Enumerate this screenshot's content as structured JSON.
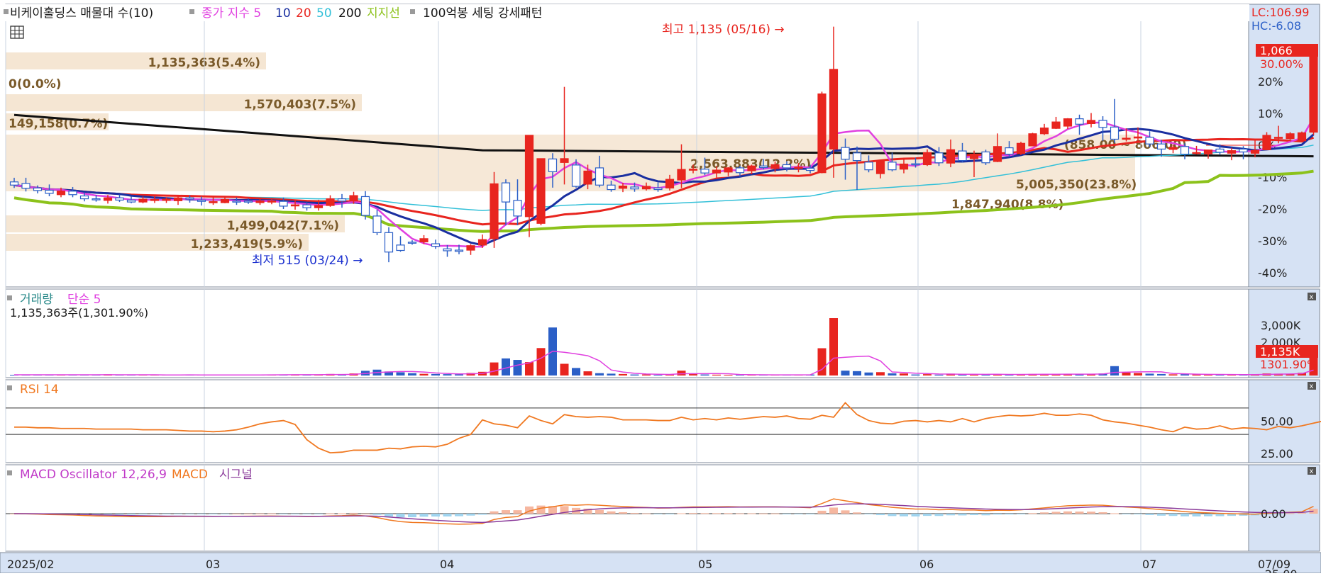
{
  "header": {
    "stock_title": "비케이홀딩스 매물대 수(10)",
    "close_label": "종가 지수 5",
    "ma": [
      "10",
      "20",
      "50",
      "200"
    ],
    "support_label": "지지선",
    "pattern_label": "100억봉 세팅 강세패턴"
  },
  "right_labels": {
    "lc": "LC:106.99",
    "hc": "HC:-6.08",
    "last_price": "1,066",
    "last_pct": "30.00%"
  },
  "annotations": {
    "high": "최고 1,135 (05/16) →",
    "low": "최저 515 (03/24) →"
  },
  "volume_panel": {
    "title": "거래량",
    "ma_label": "단순 5",
    "info": "1,135,363주(1,301.90%)",
    "badge": "1,135K",
    "badge_pct": "1301.90%"
  },
  "rsi_panel": {
    "title": "RSI 14"
  },
  "macd_panel": {
    "title": "MACD Oscillator 12,26,9",
    "macd_label": "MACD",
    "signal_label": "시그널"
  },
  "colors": {
    "up": "#e8251f",
    "down": "#2b5fc7",
    "ma5": "#e040e0",
    "ma10": "#1a2fa0",
    "ma20": "#e8251f",
    "ma50": "#33c0d8",
    "ma200": "#111111",
    "support": "#8cc21b",
    "vp": "#f5e6d3",
    "vp_text": "#7a5a2a",
    "rsi": "#f07820",
    "macd_pos": "#f6b7a0",
    "macd_neg": "#9fd4ef",
    "signal": "#8a3a9a"
  },
  "chart_data": {
    "type": "candlestick",
    "x_ticks": [
      "2025/02",
      "03",
      "04",
      "05",
      "06",
      "07",
      "07/09"
    ],
    "price_axis": {
      "ticks": [
        "30.00%",
        "20%",
        "10%",
        "0%",
        "-10%",
        "-20%",
        "-30%",
        "-40%"
      ]
    },
    "volume_axis": {
      "ticks": [
        "3,000K",
        "2,000K"
      ]
    },
    "rsi_axis": {
      "ticks": [
        "50.00"
      ]
    },
    "macd_axis": {
      "ticks": [
        "25.00",
        "0.00",
        "-25.00"
      ]
    },
    "volume_profile": [
      {
        "label": "1,135,363(5.4%)",
        "pct": 5.4
      },
      {
        "label": "0(0.0%)",
        "pct": 0
      },
      {
        "label": "1,570,403(7.5%)",
        "pct": 7.5
      },
      {
        "label": "149,158(0.7%)",
        "pct": 0.7
      },
      {
        "label": "5,005,350(23.8%)",
        "pct": 23.8
      },
      {
        "label": "2,563,883(12.2%)",
        "pct": 12.2
      },
      {
        "label": "1,847,940(8.8%)",
        "pct": 8.8
      },
      {
        "label": "1,499,042(7.1%)",
        "pct": 7.1
      },
      {
        "label": "1,233,419(5.9%)",
        "pct": 5.9
      }
    ],
    "max_zone_label": "(858.00 ~ 806.00)",
    "candles": [
      {
        "o": -11.5,
        "h": -10.2,
        "l": -13.4,
        "c": -12.5,
        "v": 40
      },
      {
        "o": -12,
        "h": -10.2,
        "l": -14.5,
        "c": -13.5,
        "v": 50
      },
      {
        "o": -13.4,
        "h": -12.6,
        "l": -15.1,
        "c": -14.2,
        "v": 40
      },
      {
        "o": -14.1,
        "h": -12.3,
        "l": -16,
        "c": -15.1,
        "v": 50
      },
      {
        "o": -15.5,
        "h": -13.3,
        "l": -16.3,
        "c": -14.4,
        "v": 40
      },
      {
        "o": -14.4,
        "h": -13.1,
        "l": -16.3,
        "c": -15.5,
        "v": 35
      },
      {
        "o": -15.9,
        "h": -14.8,
        "l": -17.6,
        "c": -16.8,
        "v": 50
      },
      {
        "o": -16.8,
        "h": -15.6,
        "l": -17.7,
        "c": -17.1,
        "v": 40
      },
      {
        "o": -17.3,
        "h": -15.6,
        "l": -18.3,
        "c": -16.5,
        "v": 70
      },
      {
        "o": -16.5,
        "h": -15.5,
        "l": -17.8,
        "c": -17.2,
        "v": 30
      },
      {
        "o": -17.2,
        "h": -16.1,
        "l": -18.2,
        "c": -17.8,
        "v": 25
      },
      {
        "o": -17.8,
        "h": -16.1,
        "l": -18.2,
        "c": -16.9,
        "v": 40
      },
      {
        "o": -17.1,
        "h": -15.9,
        "l": -18.1,
        "c": -17,
        "v": 40
      },
      {
        "o": -17.3,
        "h": -16.4,
        "l": -18.1,
        "c": -16.9,
        "v": 30
      },
      {
        "o": -17.4,
        "h": -16.1,
        "l": -18.7,
        "c": -16.5,
        "v": 35
      },
      {
        "o": -16.5,
        "h": -15.7,
        "l": -18,
        "c": -16.9,
        "v": 30
      },
      {
        "o": -17.2,
        "h": -16.1,
        "l": -18.9,
        "c": -17.6,
        "v": 30
      },
      {
        "o": -18,
        "h": -16.4,
        "l": -18.7,
        "c": -17.7,
        "v": 25
      },
      {
        "o": -18,
        "h": -16.1,
        "l": -18.2,
        "c": -17,
        "v": 30
      },
      {
        "o": -17.5,
        "h": -16.4,
        "l": -18.7,
        "c": -17.7,
        "v": 35
      },
      {
        "o": -17.5,
        "h": -16.7,
        "l": -18.4,
        "c": -17.7,
        "v": 30
      },
      {
        "o": -18,
        "h": -16.4,
        "l": -18.7,
        "c": -17.5,
        "v": 40
      },
      {
        "o": -17.8,
        "h": -16.7,
        "l": -18.5,
        "c": -17.5,
        "v": 50
      },
      {
        "o": -17.6,
        "h": -16.4,
        "l": -20,
        "c": -19.1,
        "v": 60
      },
      {
        "o": -19,
        "h": -17.1,
        "l": -20.2,
        "c": -18.7,
        "v": 60
      },
      {
        "o": -18.7,
        "h": -17.9,
        "l": -20.5,
        "c": -19.6,
        "v": 40
      },
      {
        "o": -19.6,
        "h": -17.1,
        "l": -20.5,
        "c": -18.9,
        "v": 35
      },
      {
        "o": -18.9,
        "h": -15.7,
        "l": -19.3,
        "c": -16.8,
        "v": 90
      },
      {
        "o": -16.8,
        "h": -15.3,
        "l": -19.6,
        "c": -17.5,
        "v": 70
      },
      {
        "o": -17.5,
        "h": -14.6,
        "l": -18.4,
        "c": -15.8,
        "v": 120
      },
      {
        "o": -16.1,
        "h": -14.4,
        "l": -23.3,
        "c": -22,
        "v": 280
      },
      {
        "o": -22.2,
        "h": -20.2,
        "l": -28.2,
        "c": -27.4,
        "v": 350
      },
      {
        "o": -27.4,
        "h": -25.7,
        "l": -36.7,
        "c": -33.5,
        "v": 240
      },
      {
        "o": -31.3,
        "h": -28.5,
        "l": -33.4,
        "c": -33,
        "v": 190
      },
      {
        "o": -30.4,
        "h": -29.8,
        "l": -31.2,
        "c": -30.6,
        "v": 140
      },
      {
        "o": -30.3,
        "h": -28.2,
        "l": -31,
        "c": -29.3,
        "v": 100
      },
      {
        "o": -30.9,
        "h": -29.6,
        "l": -32.5,
        "c": -31.7,
        "v": 90
      },
      {
        "o": -32.5,
        "h": -31.3,
        "l": -35,
        "c": -33.1,
        "v": 80
      },
      {
        "o": -32.9,
        "h": -31.2,
        "l": -34.2,
        "c": -33.3,
        "v": 70
      },
      {
        "o": -32.9,
        "h": -31,
        "l": -34.4,
        "c": -31.5,
        "v": 150
      },
      {
        "o": -31.3,
        "h": -28,
        "l": -32.2,
        "c": -29.6,
        "v": 220
      },
      {
        "o": -29.3,
        "h": -8.4,
        "l": -32.2,
        "c": -12.1,
        "v": 780
      },
      {
        "o": -11.8,
        "h": -10.7,
        "l": -25.1,
        "c": -17.8,
        "v": 1020
      },
      {
        "o": -17.3,
        "h": -10.7,
        "l": -25.1,
        "c": -22.2,
        "v": 930
      },
      {
        "o": -22.4,
        "h": 3.2,
        "l": -28.8,
        "c": 3.1,
        "v": 800
      },
      {
        "o": -24.5,
        "h": -5.1,
        "l": -25.1,
        "c": -4.2,
        "v": 1640
      },
      {
        "o": -4.3,
        "h": -2.5,
        "l": -13.3,
        "c": -8.3,
        "v": 2870
      },
      {
        "o": -5.4,
        "h": 18.3,
        "l": -12.3,
        "c": -4.2,
        "v": 700
      },
      {
        "o": -6.2,
        "h": -4.4,
        "l": -13.3,
        "c": -12.9,
        "v": 450
      },
      {
        "o": -12.2,
        "h": -6.1,
        "l": -13.8,
        "c": -8.1,
        "v": 250
      },
      {
        "o": -7.1,
        "h": -3.3,
        "l": -13.2,
        "c": -12.5,
        "v": 140
      },
      {
        "o": -12.5,
        "h": -11.1,
        "l": -14.6,
        "c": -13.9,
        "v": 110
      },
      {
        "o": -13.5,
        "h": -11.8,
        "l": -14.7,
        "c": -12.8,
        "v": 90
      },
      {
        "o": -13.1,
        "h": -11.7,
        "l": -14.6,
        "c": -13.7,
        "v": 60
      },
      {
        "o": -13.7,
        "h": -11.7,
        "l": -14.2,
        "c": -12.9,
        "v": 60
      },
      {
        "o": -13.4,
        "h": -11.7,
        "l": -14.6,
        "c": -13.9,
        "v": 40
      },
      {
        "o": -13.4,
        "h": -9.3,
        "l": -14.2,
        "c": -10.7,
        "v": 80
      },
      {
        "o": -10.9,
        "h": 0.3,
        "l": -13.4,
        "c": -7.6,
        "v": 290
      },
      {
        "o": -7.6,
        "h": -6.1,
        "l": -8.8,
        "c": -7.5,
        "v": 90
      },
      {
        "o": -7.5,
        "h": -3.9,
        "l": -9.4,
        "c": -8.7,
        "v": 60
      },
      {
        "o": -8.7,
        "h": -6.5,
        "l": -10.1,
        "c": -7.8,
        "v": 50
      },
      {
        "o": -8.4,
        "h": -6.9,
        "l": -9.7,
        "c": -7.1,
        "v": 40
      },
      {
        "o": -7.1,
        "h": -6.4,
        "l": -9.8,
        "c": -8.6,
        "v": 40
      },
      {
        "o": -8,
        "h": -6.1,
        "l": -9.1,
        "c": -6.5,
        "v": 40
      },
      {
        "o": -6.5,
        "h": -4.3,
        "l": -7.6,
        "c": -7,
        "v": 30
      },
      {
        "o": -7.3,
        "h": -5.1,
        "l": -8.5,
        "c": -6.1,
        "v": 40
      },
      {
        "o": -6.1,
        "h": -5,
        "l": -8.2,
        "c": -7.1,
        "v": 30
      },
      {
        "o": -7.3,
        "h": -5.6,
        "l": -8.5,
        "c": -6.9,
        "v": 50
      },
      {
        "o": -7.2,
        "h": -6.1,
        "l": -8.8,
        "c": -7.9,
        "v": 60
      },
      {
        "o": -8.6,
        "h": 16.8,
        "l": -8.8,
        "c": 16.1,
        "v": 1630
      },
      {
        "o": -1.2,
        "h": 37.2,
        "l": -10.2,
        "c": 23.8,
        "v": 3430
      },
      {
        "o": -0.7,
        "h": 2.1,
        "l": -10.8,
        "c": -4.4,
        "v": 290
      },
      {
        "o": -2.4,
        "h": -0.4,
        "l": -14,
        "c": -4.8,
        "v": 260
      },
      {
        "o": -5.3,
        "h": -3.2,
        "l": -8.5,
        "c": -7.7,
        "v": 180
      },
      {
        "o": -8.9,
        "h": -4.7,
        "l": -10.4,
        "c": -4.9,
        "v": 200
      },
      {
        "o": -5.3,
        "h": -2.3,
        "l": -8.2,
        "c": -7.7,
        "v": 130
      },
      {
        "o": -7.5,
        "h": -4.4,
        "l": -8.8,
        "c": -5.9,
        "v": 120
      },
      {
        "o": -5.8,
        "h": -3.9,
        "l": -7,
        "c": -6,
        "v": 60
      },
      {
        "o": -6.1,
        "h": -1.3,
        "l": -6.5,
        "c": -2.3,
        "v": 80
      },
      {
        "o": -2.4,
        "h": -0.6,
        "l": -6.5,
        "c": -5.5,
        "v": 50
      },
      {
        "o": -5.6,
        "h": 1.8,
        "l": -6.9,
        "c": -1.4,
        "v": 110
      },
      {
        "o": -1.8,
        "h": 0.7,
        "l": -5.4,
        "c": -4.8,
        "v": 80
      },
      {
        "o": -4.2,
        "h": -1.7,
        "l": -10,
        "c": -2.8,
        "v": 60
      },
      {
        "o": -2.1,
        "h": -1.4,
        "l": -6.2,
        "c": -5.5,
        "v": 50
      },
      {
        "o": -5.1,
        "h": 3.7,
        "l": -5.3,
        "c": -0.4,
        "v": 70
      },
      {
        "o": -0.8,
        "h": 1.3,
        "l": -3.7,
        "c": -2.8,
        "v": 60
      },
      {
        "o": -2.6,
        "h": 1.1,
        "l": -3.1,
        "c": 0.6,
        "v": 80
      },
      {
        "o": -0.2,
        "h": 3.9,
        "l": -0.3,
        "c": 3.6,
        "v": 90
      },
      {
        "o": 3.6,
        "h": 6.7,
        "l": 3.2,
        "c": 5.4,
        "v": 70
      },
      {
        "o": 5.3,
        "h": 8.9,
        "l": 5.1,
        "c": 7.3,
        "v": 80
      },
      {
        "o": 6,
        "h": 8.5,
        "l": 5.1,
        "c": 8.3,
        "v": 90
      },
      {
        "o": 8.3,
        "h": 9.6,
        "l": 3.3,
        "c": 6.6,
        "v": 70
      },
      {
        "o": 6.8,
        "h": 10.1,
        "l": 5.6,
        "c": 7.8,
        "v": 80
      },
      {
        "o": 7.8,
        "h": 9.1,
        "l": 1.4,
        "c": 5.6,
        "v": 120
      },
      {
        "o": 5.7,
        "h": 14.5,
        "l": 0.7,
        "c": 1.9,
        "v": 560
      },
      {
        "o": 2,
        "h": 5.3,
        "l": 1.2,
        "c": 2.2,
        "v": 180
      },
      {
        "o": 2.3,
        "h": 5.6,
        "l": 1.1,
        "c": 2.6,
        "v": 150
      },
      {
        "o": 2.5,
        "h": 4.4,
        "l": -0.6,
        "c": 0.4,
        "v": 110
      },
      {
        "o": 0.4,
        "h": 1.7,
        "l": -3.6,
        "c": -1.2,
        "v": 90
      },
      {
        "o": -1.3,
        "h": 0.1,
        "l": -2.5,
        "c": -0.7,
        "v": 70
      },
      {
        "o": -0.4,
        "h": 0.6,
        "l": -4.4,
        "c": -2.8,
        "v": 80
      },
      {
        "o": -2.4,
        "h": -0.2,
        "l": -2.9,
        "c": -2.3,
        "v": 60
      },
      {
        "o": -2.7,
        "h": -1.4,
        "l": -4.2,
        "c": -1.5,
        "v": 50
      },
      {
        "o": -1.2,
        "h": 0.3,
        "l": -3,
        "c": -2.2,
        "v": 50
      },
      {
        "o": -2.5,
        "h": -0.8,
        "l": -4.7,
        "c": -1.7,
        "v": 40
      },
      {
        "o": -1.2,
        "h": -0.3,
        "l": -4.4,
        "c": -2.1,
        "v": 60
      },
      {
        "o": -2.5,
        "h": 1.5,
        "l": -3.8,
        "c": -1.6,
        "v": 70
      },
      {
        "o": -1.4,
        "h": 4.1,
        "l": -1.5,
        "c": 3.1,
        "v": 120
      },
      {
        "o": 2.4,
        "h": 6.1,
        "l": 0.6,
        "c": 2.5,
        "v": 110
      },
      {
        "o": 2.1,
        "h": 4.1,
        "l": 1.2,
        "c": 3.6,
        "v": 90
      },
      {
        "o": 1.4,
        "h": 4.3,
        "l": 1.1,
        "c": 3.9,
        "v": 160
      },
      {
        "o": 4.1,
        "h": 30,
        "l": 3.2,
        "c": 30,
        "v": 1135
      }
    ],
    "rsi": [
      41,
      41,
      40,
      40,
      39,
      39,
      39,
      38,
      38,
      38,
      38,
      37,
      37,
      37,
      36,
      35,
      35,
      34,
      35,
      37,
      41,
      46,
      49,
      51,
      45,
      22,
      9,
      2,
      3,
      6,
      6,
      6,
      9,
      8,
      11,
      12,
      11,
      15,
      24,
      30,
      52,
      46,
      44,
      40,
      58,
      51,
      46,
      60,
      57,
      56,
      57,
      56,
      52,
      52,
      52,
      51,
      51,
      56,
      52,
      54,
      52,
      55,
      53,
      55,
      57,
      56,
      58,
      54,
      53,
      59,
      56,
      78,
      60,
      51,
      47,
      46,
      50,
      51,
      49,
      51,
      49,
      54,
      49,
      54,
      57,
      59,
      58,
      59,
      62,
      59,
      59,
      61,
      59,
      52,
      49,
      47,
      44,
      41,
      37,
      34,
      41,
      38,
      39,
      43,
      38,
      40,
      39,
      37,
      42,
      40,
      43,
      47,
      51,
      49,
      52,
      55,
      50,
      79
    ],
    "macd_osc": [
      -4,
      -4,
      -4,
      -4,
      -4,
      -4,
      -4,
      -4,
      -4,
      -4,
      -4,
      -4,
      -4,
      -4,
      -4,
      -4,
      -4,
      -4,
      -4,
      -4,
      -4,
      -4,
      -4,
      -4,
      -4,
      -4,
      -4,
      -4,
      -4,
      -4,
      -4,
      -4,
      -4,
      -4,
      -4,
      -4,
      -4,
      -4,
      -4,
      -4,
      -4,
      -4,
      -4,
      -4,
      -4,
      -4,
      -4,
      -4,
      -4,
      -4,
      -4,
      -4,
      -4,
      -4,
      -4,
      -4,
      -4,
      -4,
      -4,
      -4,
      -4,
      -4,
      -4,
      -4,
      -4,
      -4,
      -4,
      -4,
      -4,
      -4,
      -4,
      -4,
      -4,
      -4,
      -4,
      -4,
      -4,
      -4,
      -4,
      -4,
      -4,
      -4,
      -4,
      -4,
      -4,
      -4,
      -4,
      -4,
      -4,
      -4,
      -4,
      -4,
      -4,
      -4,
      -4,
      -4,
      -4,
      -4,
      -4,
      -4,
      -4,
      -4,
      -4,
      -4,
      -4,
      -4,
      -4,
      -4,
      -4,
      -4,
      -4,
      -4,
      -4,
      -4,
      -4,
      -4,
      -4,
      -4,
      -4,
      -4
    ]
  }
}
